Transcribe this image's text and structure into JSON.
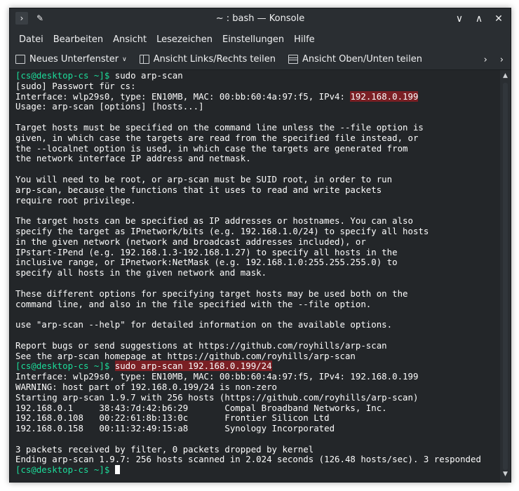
{
  "window": {
    "title": "~ : bash — Konsole"
  },
  "titlebar_icons": [
    "terminal-icon",
    "pin-icon"
  ],
  "window_controls": [
    "chevron-down-icon",
    "chevron-up-icon",
    "close-icon"
  ],
  "menu": [
    "Datei",
    "Bearbeiten",
    "Ansicht",
    "Lesezeichen",
    "Einstellungen",
    "Hilfe"
  ],
  "toolbar": {
    "new_tab": "Neues Unterfenster",
    "split_lr": "Ansicht Links/Rechts teilen",
    "split_tb": "Ansicht Oben/Unten teilen"
  },
  "colors": {
    "prompt": "#1cdc9a",
    "highlight": "#7a1f24",
    "background": "#232629"
  },
  "terminal": {
    "lines": [
      {
        "prompt": "[cs@desktop-cs ~]$",
        "text": " sudo arp-scan"
      },
      {
        "text": "[sudo] Passwort für cs:"
      },
      {
        "text": "Interface: wlp29s0, type: EN10MB, MAC: 00:bb:60:4a:97:f5, IPv4: ",
        "hl": "192.168.0.199"
      },
      {
        "text": "Usage: arp-scan [options] [hosts...]"
      },
      {
        "text": ""
      },
      {
        "text": "Target hosts must be specified on the command line unless the --file option is"
      },
      {
        "text": "given, in which case the targets are read from the specified file instead, or"
      },
      {
        "text": "the --localnet option is used, in which case the targets are generated from"
      },
      {
        "text": "the network interface IP address and netmask."
      },
      {
        "text": ""
      },
      {
        "text": "You will need to be root, or arp-scan must be SUID root, in order to run"
      },
      {
        "text": "arp-scan, because the functions that it uses to read and write packets"
      },
      {
        "text": "require root privilege."
      },
      {
        "text": ""
      },
      {
        "text": "The target hosts can be specified as IP addresses or hostnames. You can also"
      },
      {
        "text": "specify the target as IPnetwork/bits (e.g. 192.168.1.0/24) to specify all hosts"
      },
      {
        "text": "in the given network (network and broadcast addresses included), or"
      },
      {
        "text": "IPstart-IPend (e.g. 192.168.1.3-192.168.1.27) to specify all hosts in the"
      },
      {
        "text": "inclusive range, or IPnetwork:NetMask (e.g. 192.168.1.0:255.255.255.0) to"
      },
      {
        "text": "specify all hosts in the given network and mask."
      },
      {
        "text": ""
      },
      {
        "text": "These different options for specifying target hosts may be used both on the"
      },
      {
        "text": "command line, and also in the file specified with the --file option."
      },
      {
        "text": ""
      },
      {
        "text": "use \"arp-scan --help\" for detailed information on the available options."
      },
      {
        "text": ""
      },
      {
        "text": "Report bugs or send suggestions at https://github.com/royhills/arp-scan"
      },
      {
        "text": "See the arp-scan homepage at https://github.com/royhills/arp-scan"
      },
      {
        "prompt": "[cs@desktop-cs ~]$",
        "text": " ",
        "hl": "sudo arp-scan 192.168.0.199/24"
      },
      {
        "text": "Interface: wlp29s0, type: EN10MB, MAC: 00:bb:60:4a:97:f5, IPv4: 192.168.0.199"
      },
      {
        "text": "WARNING: host part of 192.168.0.199/24 is non-zero"
      },
      {
        "text": "Starting arp-scan 1.9.7 with 256 hosts (https://github.com/royhills/arp-scan)"
      },
      {
        "text": "192.168.0.1     38:43:7d:42:b6:29       Compal Broadband Networks, Inc."
      },
      {
        "text": "192.168.0.108   00:22:61:8b:13:0c       Frontier Silicon Ltd"
      },
      {
        "text": "192.168.0.158   00:11:32:49:15:a8       Synology Incorporated"
      },
      {
        "text": ""
      },
      {
        "text": "3 packets received by filter, 0 packets dropped by kernel"
      },
      {
        "text": "Ending arp-scan 1.9.7: 256 hosts scanned in 2.024 seconds (126.48 hosts/sec). 3 responded"
      },
      {
        "prompt": "[cs@desktop-cs ~]$",
        "text": " ",
        "cursor": true
      }
    ]
  }
}
